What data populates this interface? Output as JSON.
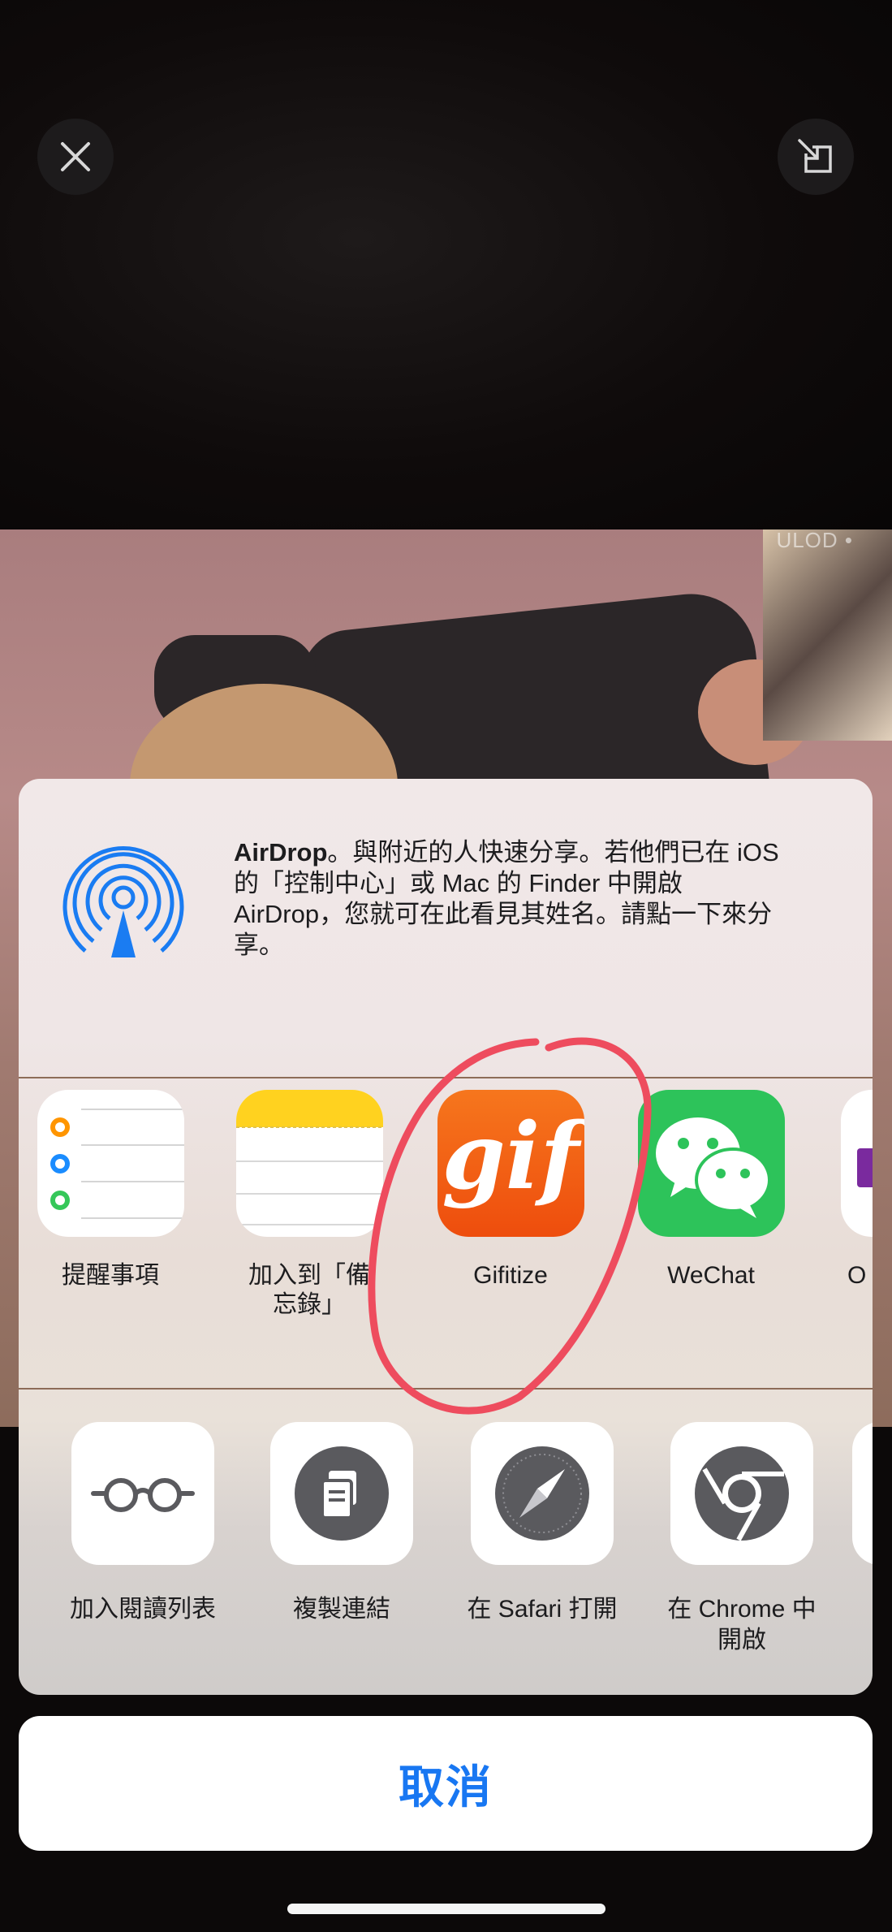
{
  "top_bar": {
    "close_icon": "close-icon",
    "minimize_icon": "picture-in-picture-icon"
  },
  "video": {
    "watermark": "ULOD •"
  },
  "airdrop": {
    "icon": "airdrop-icon",
    "title": "AirDrop",
    "message_line1": "。與附近的人快速分享。若他們已在 iOS",
    "message_line2": "的「控制中心」或 Mac 的 Finder 中開啟",
    "message_line3": "AirDrop，您就可在此看見其姓名。請點一下來分",
    "message_line4": "享。"
  },
  "apps": [
    {
      "label": "提醒事項",
      "icon": "reminders-icon"
    },
    {
      "label": "加入到「備\n忘錄」",
      "icon": "notes-icon"
    },
    {
      "label": "Gifitize",
      "icon": "gifitize-icon",
      "icon_text": "gif"
    },
    {
      "label": "WeChat",
      "icon": "wechat-icon"
    },
    {
      "label": "O",
      "icon": "onenote-icon"
    }
  ],
  "actions": [
    {
      "label": "加入閱讀列表",
      "icon": "reading-list-icon"
    },
    {
      "label": "複製連結",
      "icon": "copy-link-icon"
    },
    {
      "label": "在 Safari 打開",
      "icon": "safari-icon"
    },
    {
      "label": "在 Chrome 中\n開啟",
      "icon": "chrome-icon"
    }
  ],
  "cancel_label": "取消",
  "colors": {
    "accent": "#1877f2",
    "gifitize": "#f05a12",
    "wechat": "#2dc35a",
    "annotation": "#ee4c5e"
  }
}
